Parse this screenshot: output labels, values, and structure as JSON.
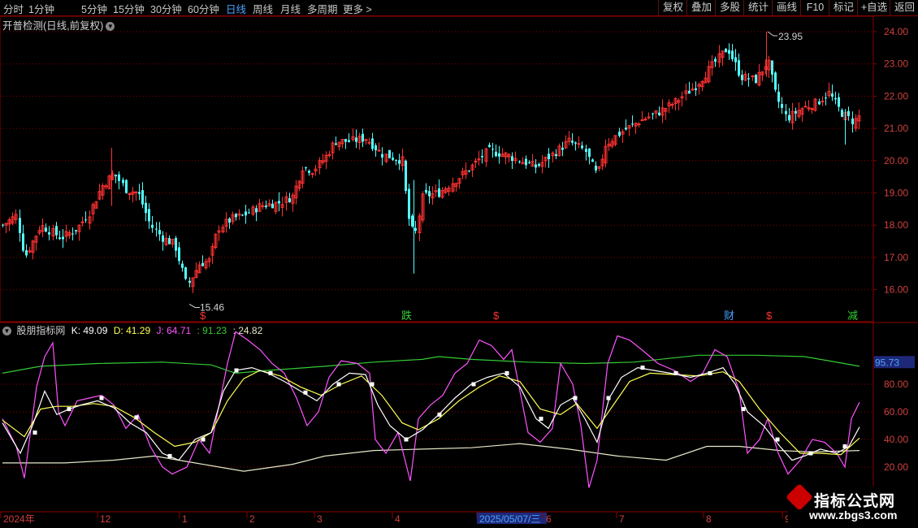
{
  "toolbar": {
    "periods": [
      "分时",
      "1分钟",
      "5分钟",
      "15分钟",
      "30分钟",
      "60分钟",
      "日线",
      "周线",
      "月线",
      "多周期",
      "更多 >"
    ],
    "active_period": "日线",
    "buttons": [
      "复权",
      "叠加",
      "多股",
      "统计",
      "画线",
      "F10",
      "标记",
      "+自选",
      "返回"
    ]
  },
  "main_chart": {
    "title": "开普检测(日线,前复权)",
    "y_ticks": [
      "24.00",
      "23.00",
      "22.00",
      "21.00",
      "20.00",
      "19.00",
      "18.00",
      "17.00",
      "16.00"
    ],
    "high_label": "23.95",
    "low_label": "15.46",
    "markers": [
      "$",
      "跌",
      "$",
      "财",
      "$",
      "减"
    ]
  },
  "indicator": {
    "name": "股朋指标网",
    "k_label": "K: 49.09",
    "d_label": "D: 41.29",
    "j_label": "J: 64.71",
    "g_label": ": 91.23",
    "w_label": ": 24.82",
    "y_ticks": [
      "80.00",
      "60.00",
      "40.00",
      "20.00"
    ],
    "highlight_value": "95.73"
  },
  "x_axis": {
    "labels": [
      "2024年",
      "12",
      "1",
      "2",
      "3",
      "4",
      "2025/05/07/三",
      "6",
      "7",
      "8",
      "9"
    ]
  },
  "watermark": {
    "line1": "指标公式网",
    "line2": "www.zbgs3.com"
  },
  "colors": {
    "up": "#ff3232",
    "down": "#54ffff",
    "k": "#ffffff",
    "d": "#ffff54",
    "j": "#ff54ff",
    "upper": "#33cc33",
    "lower": "#e8e8c8",
    "grid": "#8b0000"
  }
}
